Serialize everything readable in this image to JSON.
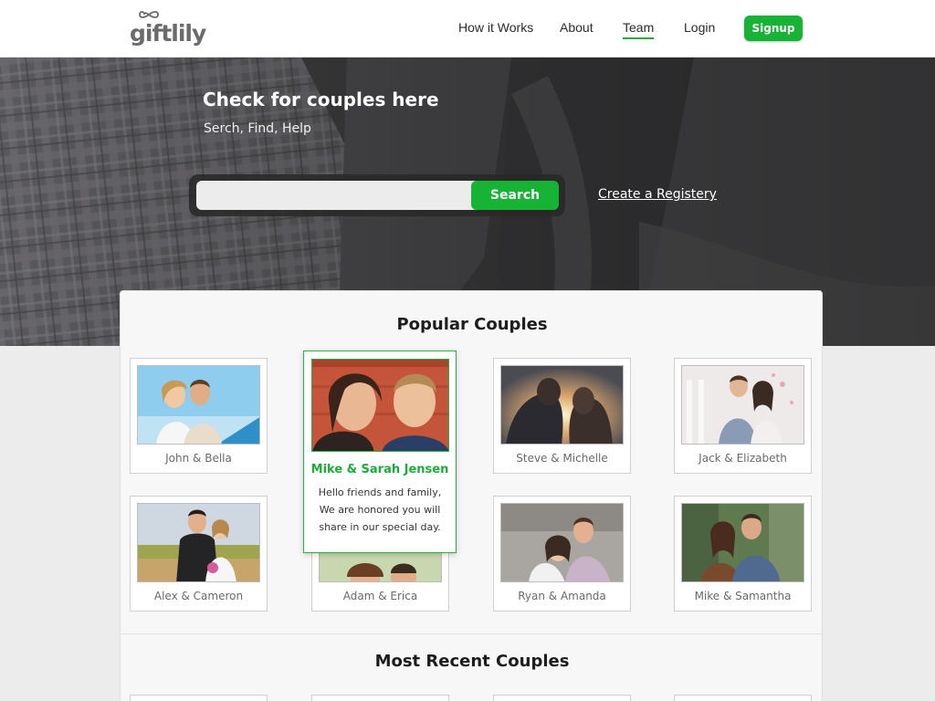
{
  "brand": {
    "name": "giftlily",
    "accent": "#17b335"
  },
  "nav": {
    "items": [
      {
        "label": "How it Works",
        "active": false
      },
      {
        "label": "About",
        "active": false
      },
      {
        "label": "Team",
        "active": true
      },
      {
        "label": "Login",
        "active": false
      }
    ],
    "signup_label": "Signup"
  },
  "hero": {
    "title": "Check for couples here",
    "subtitle": "Serch, Find, Help",
    "search_value": "",
    "search_button": "Search",
    "create_link": "Create a Registery"
  },
  "popular": {
    "title": "Popular Couples",
    "couples": [
      {
        "name": "John & Bella"
      },
      {
        "name": "Steve & Michelle"
      },
      {
        "name": "Jack & Elizabeth"
      },
      {
        "name": "Alex & Cameron"
      },
      {
        "name": "Adam & Erica"
      },
      {
        "name": "Ryan & Amanda"
      },
      {
        "name": "Mike & Samantha"
      }
    ],
    "featured": {
      "name": "Mike & Sarah Jensen",
      "message": "Hello friends and family, We are honored you will share in our special day."
    }
  },
  "recent": {
    "title": "Most Recent Couples"
  }
}
